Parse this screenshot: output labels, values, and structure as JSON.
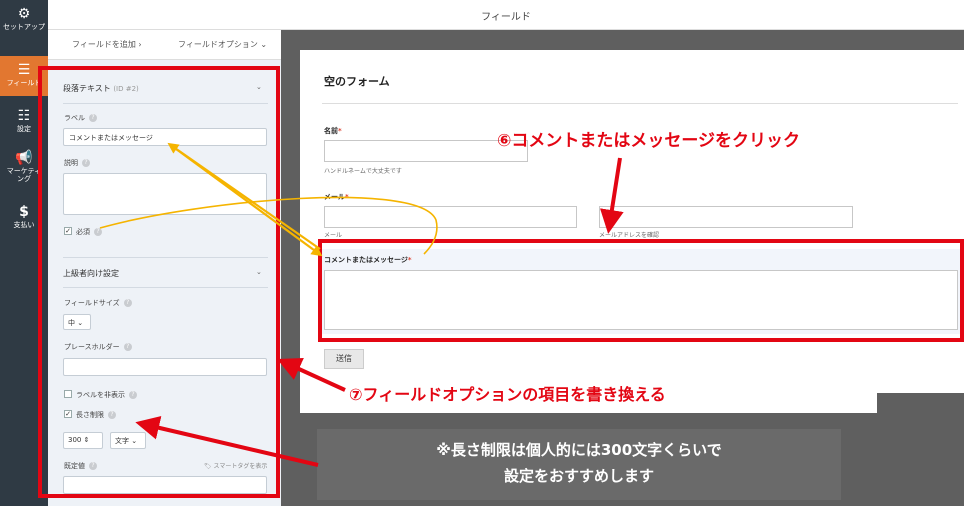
{
  "sidebar": {
    "items": [
      {
        "icon": "gear-icon",
        "label": "セットアップ"
      },
      {
        "icon": "list-icon",
        "label": "フィールド"
      },
      {
        "icon": "sliders-icon",
        "label": "設定"
      },
      {
        "icon": "megaphone-icon",
        "label": "マーケティング"
      },
      {
        "icon": "dollar-icon",
        "label": "支払い"
      }
    ],
    "active_color": "#e27730"
  },
  "topbar": {
    "title": "フィールド"
  },
  "tabs": {
    "add_field": "フィールドを追加 ›",
    "field_options": "フィールドオプション ⌄"
  },
  "options": {
    "section_title": "段落テキスト",
    "section_id": "(ID #2)",
    "label_label": "ラベル",
    "label_value": "コメントまたはメッセージ",
    "description_label": "説明",
    "required_label": "必須",
    "advanced_title": "上級者向け設定",
    "field_size_label": "フィールドサイズ",
    "field_size_value": "中",
    "placeholder_label": "プレースホルダー",
    "hide_label": "ラベルを非表示",
    "limit_length_label": "長さ制限",
    "limit_value": "300",
    "limit_unit": "文字",
    "default_label": "既定値",
    "smart_tag": "スマートタグを表示",
    "help_glyph": "?"
  },
  "preview": {
    "form_title": "空のフォーム",
    "name_label": "名前",
    "name_sub": "ハンドルネームで大丈夫です",
    "email_label": "メール",
    "email_sub": "メール",
    "email_confirm_sub": "メールアドレスを確認",
    "comment_label": "コメントまたはメッセージ",
    "required_mark": "*",
    "submit": "送信"
  },
  "annotations": {
    "step6": "⑥コメントまたはメッセージをクリック",
    "step7": "⑦フィールドオプションの項目を書き換える",
    "note_line1": "※長さ制限は個人的には300文字くらいで",
    "note_line2": "設定をおすすめします"
  },
  "colors": {
    "annotation_red": "#e30613",
    "arrow_yellow": "#f5b400",
    "panel_bg": "#eef2f7",
    "sidebar_bg": "#2f3a44"
  }
}
